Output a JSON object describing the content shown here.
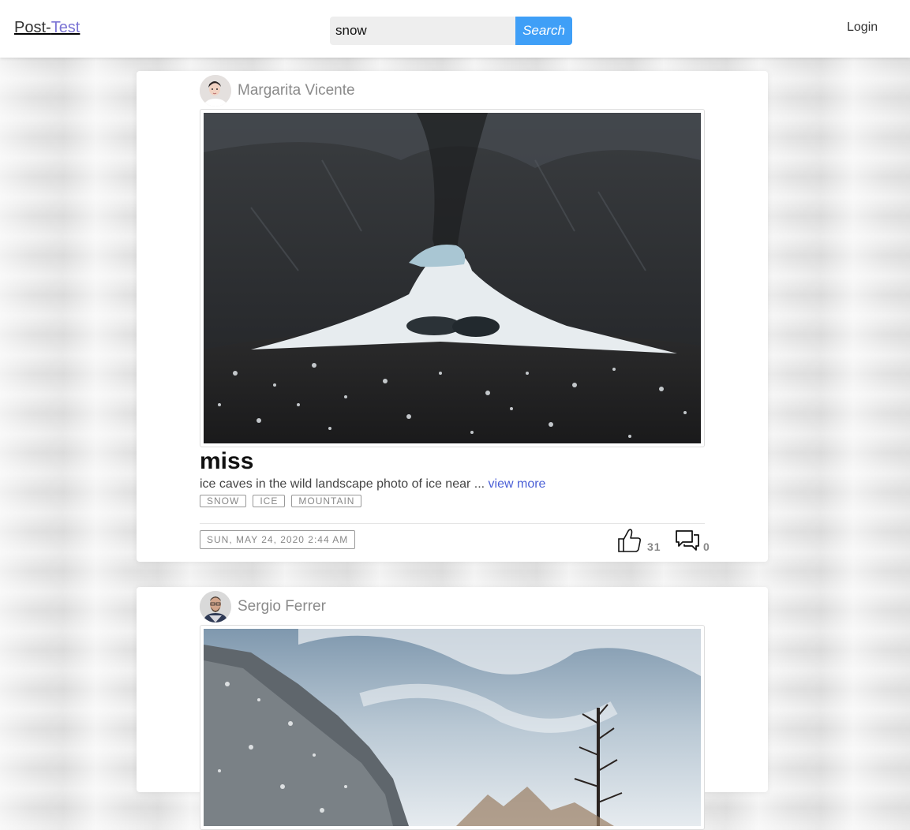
{
  "header": {
    "brand_part1": "Post-",
    "brand_part2": "Test",
    "search_value": "snow",
    "search_button": "Search",
    "login_label": "Login"
  },
  "posts": [
    {
      "author": "Margarita Vicente",
      "title": "miss",
      "description": "ice caves in the wild landscape photo of ice near ... ",
      "view_more": "view more",
      "tags": [
        "SNOW",
        "ICE",
        "MOUNTAIN"
      ],
      "date": "SUN, MAY 24, 2020 2:44 AM",
      "likes": "31",
      "comments": "0"
    },
    {
      "author": "Sergio Ferrer"
    }
  ],
  "icons": {
    "like": "thumbs-up-icon",
    "comment": "comment-icon"
  },
  "colors": {
    "accent": "#3f9ff7",
    "brand": "#7a73d4",
    "link": "#4a5fd6"
  }
}
